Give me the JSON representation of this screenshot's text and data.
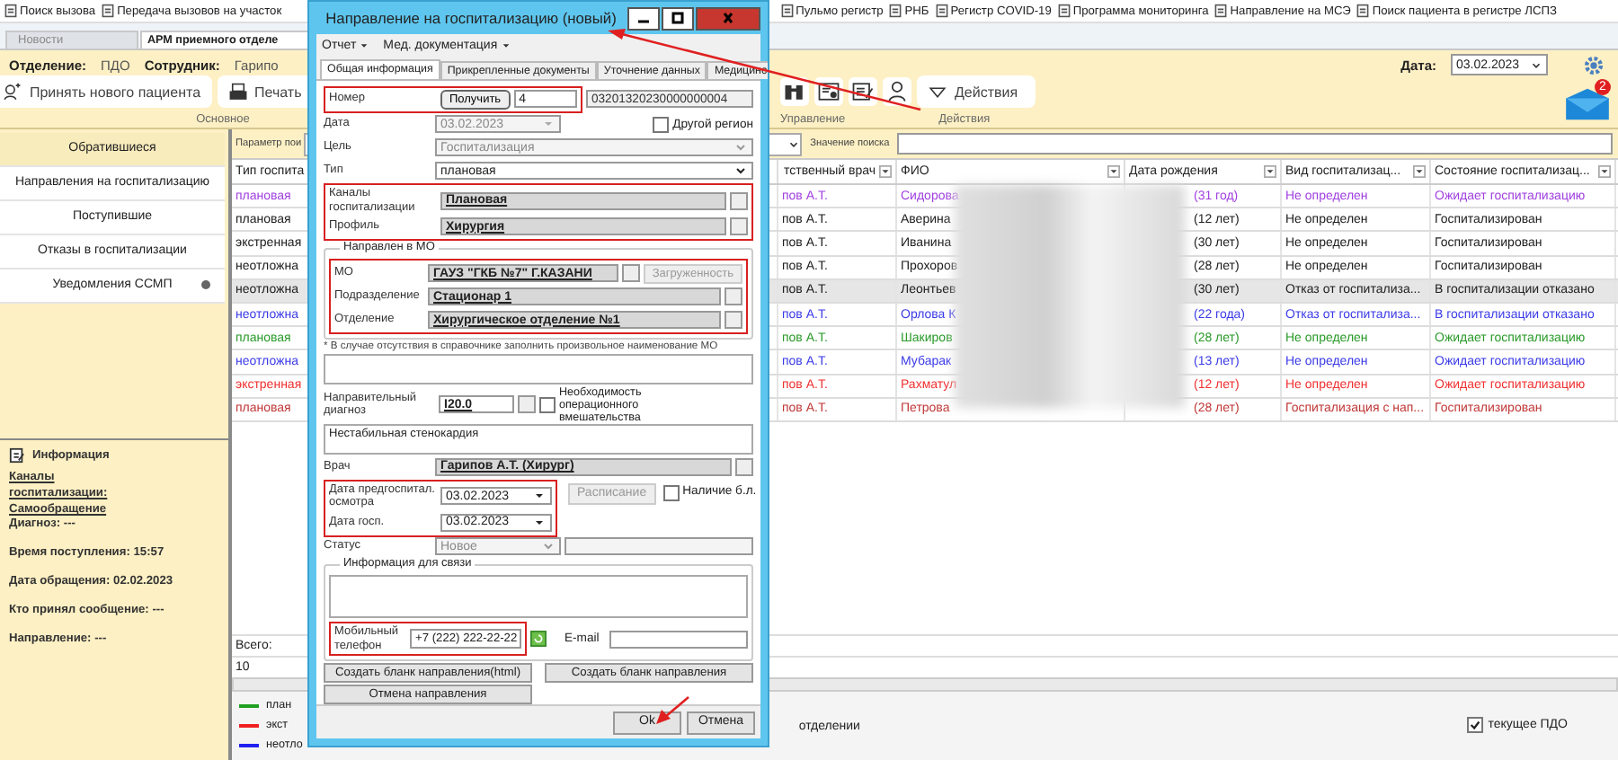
{
  "top_toolbar": {
    "left": [
      "Поиск вызова",
      "Передача вызовов на участок"
    ],
    "right": [
      "Пульмо регистр",
      "РНБ",
      "Регистр COVID-19",
      "Программа мониторинга",
      "Направление на МСЭ",
      "Поиск пациента в регистре ЛСПЗ"
    ]
  },
  "doc_tabs": [
    {
      "label": "Новости",
      "selected": false
    },
    {
      "label": "АРМ приемного отделе",
      "selected": true
    }
  ],
  "header": {
    "department_label": "Отделение:",
    "department": "ПДО",
    "employee_label": "Сотрудник:",
    "employee": "Гарипо",
    "date_label": "Дата:",
    "date": "03.02.2023"
  },
  "ribbon": {
    "new_patient": "Принять нового пациента",
    "print": "Печать",
    "actions": "Действия",
    "groups": [
      "Основное",
      "Управление",
      "Действия"
    ],
    "mail_badge": "2"
  },
  "sidebar": {
    "items": [
      {
        "label": "Обратившиеся",
        "selected": true,
        "notify": false
      },
      {
        "label": "Направления на госпитализацию",
        "selected": false,
        "notify": false
      },
      {
        "label": "Поступившие",
        "selected": false,
        "notify": false
      },
      {
        "label": "Отказы в госпитализации",
        "selected": false,
        "notify": false
      },
      {
        "label": "Уведомления ССМП",
        "selected": false,
        "notify": true
      }
    ],
    "info": {
      "title": "Информация",
      "lines": [
        {
          "kind": "link",
          "text": "Каналы госпитализации: Самообращение"
        },
        {
          "kind": "plain",
          "text": "Диагноз: ---"
        },
        {
          "kind": "gap",
          "text": "Время поступления: 15:57"
        },
        {
          "kind": "gap",
          "text": "Дата обращения: 02.02.2023"
        },
        {
          "kind": "gap",
          "text": "Кто принял сообщение: ---"
        },
        {
          "kind": "gap",
          "text": "Направление: ---"
        }
      ]
    }
  },
  "search": {
    "param_label": "Параметр пои",
    "value_label": "Значение поиска"
  },
  "table": {
    "columns": [
      "Тип госпита",
      "тственный врач",
      "ФИО",
      "Дата рождения",
      "Вид  госпитализац...",
      "Состояние  госпитализац..."
    ],
    "rows": [
      {
        "type": "плановая",
        "doctor": "пов А.Т.",
        "name": "Сидорова",
        "age": "(31 год)",
        "kind": "Не определен",
        "state": "Ожидает госпитализацию",
        "color": "#a040e0",
        "selected": false
      },
      {
        "type": "плановая",
        "doctor": "пов А.Т.",
        "name": "Аверина",
        "age": "(12 лет)",
        "kind": "Не определен",
        "state": "Госпитализирован",
        "color": "#202020",
        "selected": false
      },
      {
        "type": "экстренная",
        "doctor": "пов А.Т.",
        "name": "Иванина",
        "age": "(30 лет)",
        "kind": "Не определен",
        "state": "Госпитализирован",
        "color": "#202020",
        "selected": false
      },
      {
        "type": "неотложна",
        "doctor": "пов А.Т.",
        "name": "Прохоров",
        "age": "(28 лет)",
        "kind": "Не определен",
        "state": "Госпитализирован",
        "color": "#202020",
        "selected": false
      },
      {
        "type": "неотложна",
        "doctor": "пов А.Т.",
        "name": "Леонтьев",
        "age": "(30 лет)",
        "kind": "Отказ от госпитализа...",
        "state": "В госпитализации отказано",
        "color": "#202020",
        "selected": true
      },
      {
        "type": "неотложна",
        "doctor": "пов А.Т.",
        "name": "Орлова К",
        "age": "(22 года)",
        "kind": "Отказ от госпитализа...",
        "state": "В госпитализации отказано",
        "color": "#3a3ae8",
        "selected": false
      },
      {
        "type": "плановая",
        "doctor": "пов А.Т.",
        "name": "Шакиров",
        "age": "(28 лет)",
        "kind": "Не определен",
        "state": "Ожидает госпитализацию",
        "color": "#2a9a2a",
        "selected": false
      },
      {
        "type": "неотложна",
        "doctor": "пов А.Т.",
        "name": "Мубарак",
        "age": "(13 лет)",
        "kind": "Не определен",
        "state": "Ожидает госпитализацию",
        "color": "#3a3ae8",
        "selected": false
      },
      {
        "type": "экстренная",
        "doctor": "пов А.Т.",
        "name": "Рахматул",
        "age": "(12 лет)",
        "kind": "Не определен",
        "state": "Ожидает госпитализацию",
        "color": "#f03030",
        "selected": false
      },
      {
        "type": "плановая",
        "doctor": "пов А.Т.",
        "name": "Петрова",
        "age": "(28 лет)",
        "kind": "Госпитализация с нап...",
        "state": "Госпитализирован",
        "color": "#c03838",
        "selected": false
      }
    ]
  },
  "footer": {
    "total_label": "Всего:",
    "count": "10",
    "legend": [
      {
        "label": "план",
        "color": "#20a020"
      },
      {
        "label": "экст",
        "color": "#f02020"
      },
      {
        "label": "неотло",
        "color": "#2020f0"
      }
    ],
    "note": "отделении",
    "current": {
      "label": "текущее ПДО",
      "checked": true
    }
  },
  "dialog": {
    "title": "Направление на госпитализацию (новый)",
    "menu": [
      "Отчет",
      "Мед. документация"
    ],
    "tabs": [
      {
        "label": "Общая информация",
        "selected": true
      },
      {
        "label": "Прикрепленные документы",
        "selected": false
      },
      {
        "label": "Уточнение данных",
        "selected": false
      },
      {
        "label": "Медицинс",
        "selected": false
      }
    ],
    "number": {
      "label": "Номер",
      "button": "Получить",
      "value": "4",
      "code": "03201320230000000004"
    },
    "date": {
      "label": "Дата",
      "value": "03.02.2023",
      "disabled": true
    },
    "other_region": {
      "label": "Другой регион",
      "checked": false
    },
    "goal": {
      "label": "Цель",
      "value": "Госпитализация",
      "disabled": true
    },
    "type": {
      "label": "Тип",
      "value": "плановая",
      "disabled": false
    },
    "channels": {
      "label": "Каналы госпитализации",
      "value": "Плановая"
    },
    "profile": {
      "label": "Профиль",
      "value": "Хирургия"
    },
    "mo_group": {
      "title": "Направлен в МО",
      "mo": {
        "label": "МО",
        "value": "ГАУЗ \"ГКБ №7\" Г.КАЗАНИ"
      },
      "load_button": {
        "label": "Загруженность",
        "disabled": true
      },
      "subdivision": {
        "label": "Подразделение",
        "value": "Стационар 1"
      },
      "department": {
        "label": "Отделение",
        "value": "Хирургическое отделение №1"
      }
    },
    "mo_note": "* В случае отсутствия в справочнике заполнить произвольное наименование МО",
    "diagnosis": {
      "label": "Направительный диагноз",
      "value": "I20.0"
    },
    "surgery": {
      "label": "Необходимость  операционного вмешательства",
      "checked": false
    },
    "diagnosis_text": "Нестабильная стенокардия",
    "doctor": {
      "label": "Врач",
      "value": "Гарипов А.Т. (Хирург)"
    },
    "pre_exam_date": {
      "label": "Дата предгоспитал. осмотра",
      "value": "03.02.2023"
    },
    "schedule_button": {
      "label": "Расписание",
      "disabled": true
    },
    "sick_leave": {
      "label": "Наличие б.л.",
      "checked": false
    },
    "hosp_date": {
      "label": "Дата госп.",
      "value": "03.02.2023"
    },
    "status": {
      "label": "Статус",
      "value": "Новое",
      "disabled": true
    },
    "contact_group": {
      "title": "Информация для связи",
      "phone": {
        "label": "Мобильный телефон",
        "value": "+7 (222) 222-22-22"
      },
      "email": {
        "label": "E-mail"
      }
    },
    "buttons": [
      "Создать бланк направления(html)",
      "Создать бланк направления",
      "Отмена направления"
    ],
    "footer_buttons": [
      "Ok",
      "Отмена"
    ]
  }
}
